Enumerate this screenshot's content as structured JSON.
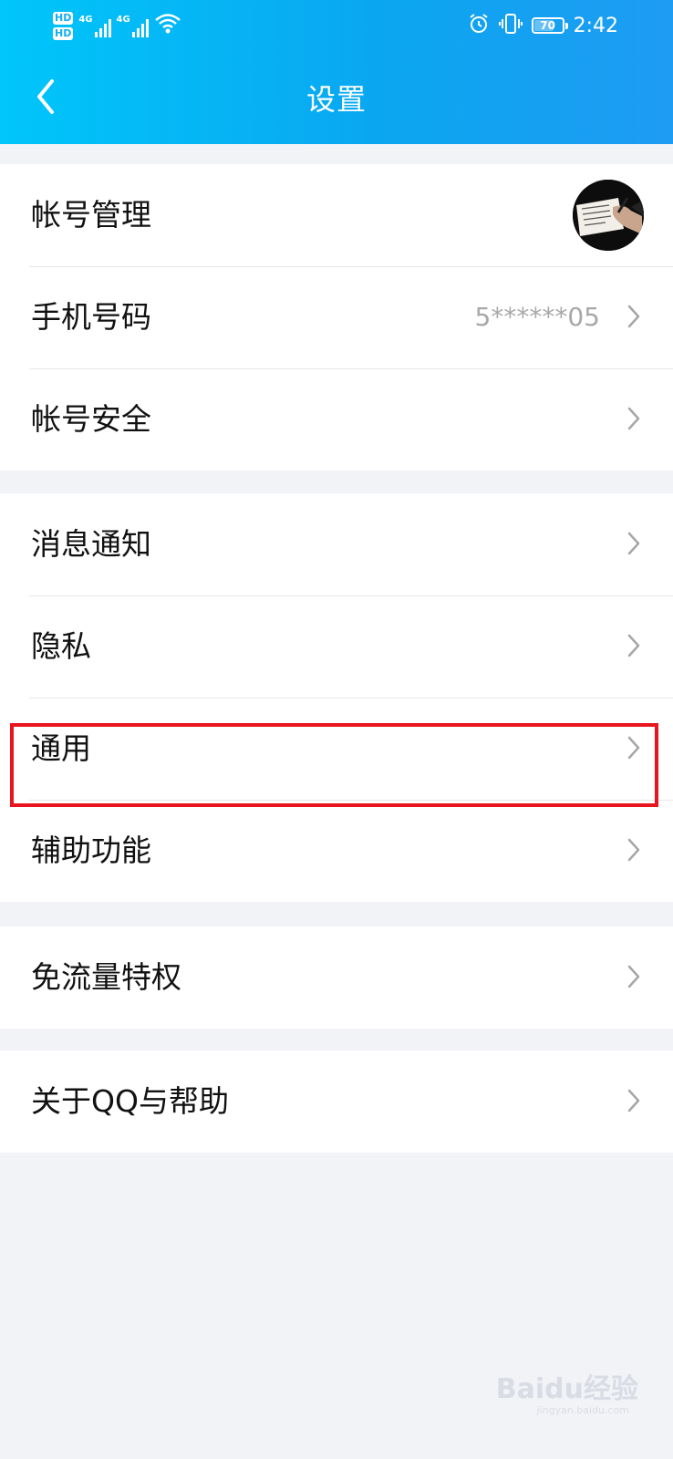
{
  "status_bar": {
    "hd1": "HD",
    "hd2": "HD",
    "net1": "4G",
    "net2": "4G",
    "battery": "70",
    "battery_level": 0.7,
    "time": "2:42",
    "icons": [
      "signal-icon",
      "wifi-icon",
      "alarm-icon",
      "vibrate-icon",
      "battery-icon"
    ]
  },
  "header": {
    "title": "设置",
    "back_icon": "chevron-left-icon",
    "gradient": [
      "#00c6fb",
      "#1e9bf2"
    ]
  },
  "groups": [
    {
      "items": [
        {
          "label": "帐号管理",
          "value": "",
          "has_avatar": true
        },
        {
          "label": "手机号码",
          "value": "5******05"
        },
        {
          "label": "帐号安全",
          "value": ""
        }
      ]
    },
    {
      "items": [
        {
          "label": "消息通知"
        },
        {
          "label": "隐私"
        },
        {
          "label": "通用",
          "highlighted": true
        },
        {
          "label": "辅助功能"
        }
      ]
    },
    {
      "items": [
        {
          "label": "免流量特权"
        }
      ]
    },
    {
      "items": [
        {
          "label": "关于QQ与帮助"
        }
      ]
    }
  ],
  "highlight_color": "#e8141e",
  "watermark": {
    "text": "Baidu经验",
    "sub": "jingyan.baidu.com"
  }
}
